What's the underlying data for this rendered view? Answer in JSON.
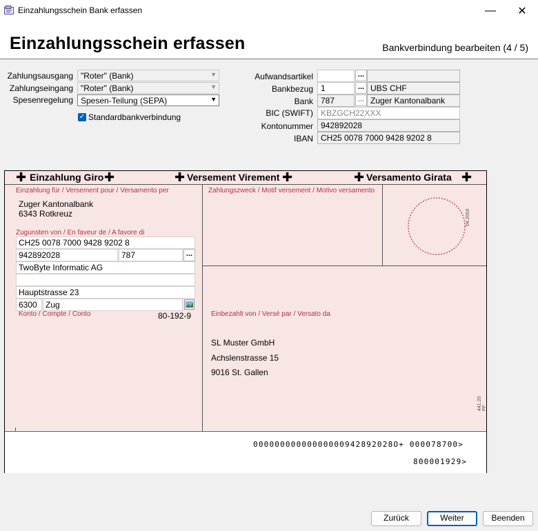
{
  "window": {
    "title": "Einzahlungsschein Bank erfassen",
    "minimize_glyph": "—",
    "close_glyph": "✕"
  },
  "header": {
    "title": "Einzahlungsschein erfassen",
    "step": "Bankverbindung bearbeiten (4 / 5)"
  },
  "form_left": {
    "zahlungsausgang_label": "Zahlungsausgang",
    "zahlungsausgang_value": "\"Roter\" (Bank)",
    "zahlungseingang_label": "Zahlungseingang",
    "zahlungseingang_value": "\"Roter\" (Bank)",
    "spesenregelung_label": "Spesenregelung",
    "spesenregelung_value": "Spesen-Teilung (SEPA)",
    "standard_label": "Standardbankverbindung",
    "standard_checked": true
  },
  "form_right": {
    "aufwandsartikel_label": "Aufwandsartikel",
    "aufwandsartikel_value": "",
    "aufwandsartikel_desc": "",
    "bankbezug_label": "Bankbezug",
    "bankbezug_value": "1",
    "bankbezug_desc": "UBS CHF",
    "bank_label": "Bank",
    "bank_value": "787",
    "bank_desc": "Zuger Kantonalbank",
    "bic_label": "BIC (SWIFT)",
    "bic_value": "KBZGCH22XXX",
    "kontonummer_label": "Kontonummer",
    "kontonummer_value": "942892028",
    "iban_label": "IBAN",
    "iban_value": "CH25 0078 7000 9428 9202 8",
    "dots": "..."
  },
  "slip": {
    "title_de": "Einzahlung Giro",
    "title_fr": "Versement Virement",
    "title_it": "Versamento Girata",
    "cross": "✚",
    "einzahlung_fuer_label": "Einzahlung für / Versement pour / Versamento per",
    "bank_line1": "Zuger Kantonalbank",
    "bank_line2": "6343 Rotkreuz",
    "zugunsten_label": "Zugunsten von / En faveur de / A favore di",
    "iban": "CH25 0078 7000 9428 9202 8",
    "konto": "942892028",
    "bank_nr": "787",
    "company": "TwoByte Informatic AG",
    "address_empty": "",
    "street": "Hauptstrasse 23",
    "zip": "6300",
    "city": "Zug",
    "konto_label": "Konto / Compte / Conto",
    "konto_nr": "80-192-9",
    "zahlungszweck_label": "Zahlungszweck / Motif versement / Motivo versamento",
    "date_code": "04.2004",
    "einbezahlt_label": "Einbezahlt von / Versé par / Versato da",
    "payer_line1": "SL Muster GmbH",
    "payer_line2": "Achslenstrasse 15",
    "payer_line3": "9016 St. Gallen",
    "form_code": "441.20 PF",
    "codeline1": "00000000000000000942892028O+ 000078700>",
    "codeline2": "800001929>"
  },
  "buttons": {
    "back": "Zurück",
    "next": "Weiter",
    "finish": "Beenden"
  }
}
